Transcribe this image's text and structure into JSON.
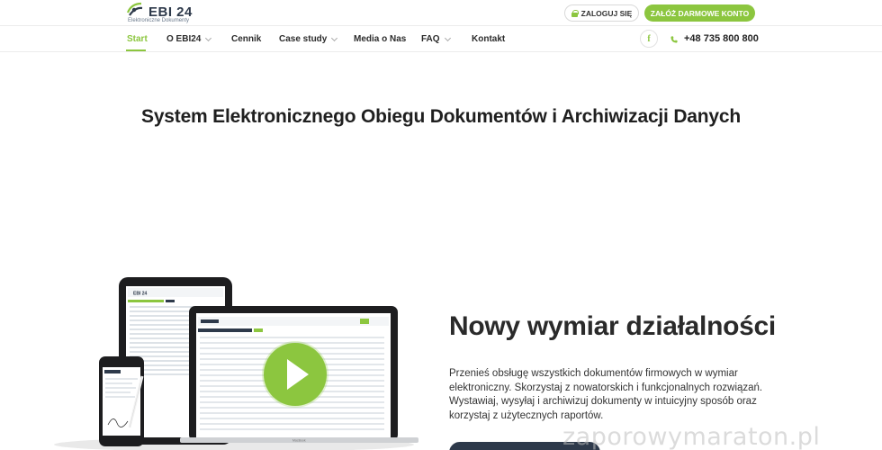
{
  "header": {
    "logo_text": "EBI 24",
    "logo_subtitle": "Elektroniczne Dokumenty",
    "login_label": "ZALOGUJ SIĘ",
    "register_label": "ZAŁÓŻ DARMOWE KONTO"
  },
  "nav": {
    "items": [
      {
        "label": "Start",
        "active": true
      },
      {
        "label": "O EBI24",
        "dropdown": true
      },
      {
        "label": "Cennik"
      },
      {
        "label": "Case study",
        "dropdown": true
      },
      {
        "label": "Media o Nas"
      },
      {
        "label": "FAQ",
        "dropdown": true
      },
      {
        "label": "Kontakt"
      }
    ],
    "facebook_icon": "facebook-icon",
    "phone": "+48 735 800 800"
  },
  "page": {
    "headline": "System Elektronicznego Obiegu Dokumentów i Archiwizacji Danych"
  },
  "hero": {
    "title": "Nowy wymiar działalności",
    "description": "Przenieś obsługę wszystkich dokumentów firmowych w wymiar elektroniczny. Skorzystaj z nowatorskich i funkcjonalnych rozwiązań. Wystawiaj, wysyłaj i archiwizuj dokumenty w intuicyjny sposób oraz korzystaj z użytecznych raportów.",
    "tablet_logo": "EBI 24",
    "laptop_label": "MacBook"
  },
  "watermark": "zaporowymaraton.pl",
  "colors": {
    "accent": "#8cc63f",
    "dark": "#2e3a4b",
    "text": "#222222"
  }
}
